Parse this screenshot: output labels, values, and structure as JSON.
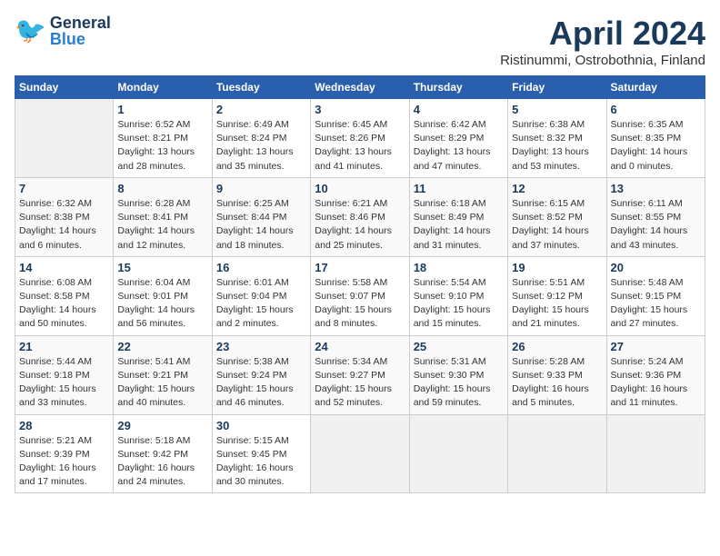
{
  "header": {
    "logo_general": "General",
    "logo_blue": "Blue",
    "month": "April 2024",
    "location": "Ristinummi, Ostrobothnia, Finland"
  },
  "weekdays": [
    "Sunday",
    "Monday",
    "Tuesday",
    "Wednesday",
    "Thursday",
    "Friday",
    "Saturday"
  ],
  "weeks": [
    [
      {
        "day": "",
        "detail": ""
      },
      {
        "day": "1",
        "detail": "Sunrise: 6:52 AM\nSunset: 8:21 PM\nDaylight: 13 hours\nand 28 minutes."
      },
      {
        "day": "2",
        "detail": "Sunrise: 6:49 AM\nSunset: 8:24 PM\nDaylight: 13 hours\nand 35 minutes."
      },
      {
        "day": "3",
        "detail": "Sunrise: 6:45 AM\nSunset: 8:26 PM\nDaylight: 13 hours\nand 41 minutes."
      },
      {
        "day": "4",
        "detail": "Sunrise: 6:42 AM\nSunset: 8:29 PM\nDaylight: 13 hours\nand 47 minutes."
      },
      {
        "day": "5",
        "detail": "Sunrise: 6:38 AM\nSunset: 8:32 PM\nDaylight: 13 hours\nand 53 minutes."
      },
      {
        "day": "6",
        "detail": "Sunrise: 6:35 AM\nSunset: 8:35 PM\nDaylight: 14 hours\nand 0 minutes."
      }
    ],
    [
      {
        "day": "7",
        "detail": "Sunrise: 6:32 AM\nSunset: 8:38 PM\nDaylight: 14 hours\nand 6 minutes."
      },
      {
        "day": "8",
        "detail": "Sunrise: 6:28 AM\nSunset: 8:41 PM\nDaylight: 14 hours\nand 12 minutes."
      },
      {
        "day": "9",
        "detail": "Sunrise: 6:25 AM\nSunset: 8:44 PM\nDaylight: 14 hours\nand 18 minutes."
      },
      {
        "day": "10",
        "detail": "Sunrise: 6:21 AM\nSunset: 8:46 PM\nDaylight: 14 hours\nand 25 minutes."
      },
      {
        "day": "11",
        "detail": "Sunrise: 6:18 AM\nSunset: 8:49 PM\nDaylight: 14 hours\nand 31 minutes."
      },
      {
        "day": "12",
        "detail": "Sunrise: 6:15 AM\nSunset: 8:52 PM\nDaylight: 14 hours\nand 37 minutes."
      },
      {
        "day": "13",
        "detail": "Sunrise: 6:11 AM\nSunset: 8:55 PM\nDaylight: 14 hours\nand 43 minutes."
      }
    ],
    [
      {
        "day": "14",
        "detail": "Sunrise: 6:08 AM\nSunset: 8:58 PM\nDaylight: 14 hours\nand 50 minutes."
      },
      {
        "day": "15",
        "detail": "Sunrise: 6:04 AM\nSunset: 9:01 PM\nDaylight: 14 hours\nand 56 minutes."
      },
      {
        "day": "16",
        "detail": "Sunrise: 6:01 AM\nSunset: 9:04 PM\nDaylight: 15 hours\nand 2 minutes."
      },
      {
        "day": "17",
        "detail": "Sunrise: 5:58 AM\nSunset: 9:07 PM\nDaylight: 15 hours\nand 8 minutes."
      },
      {
        "day": "18",
        "detail": "Sunrise: 5:54 AM\nSunset: 9:10 PM\nDaylight: 15 hours\nand 15 minutes."
      },
      {
        "day": "19",
        "detail": "Sunrise: 5:51 AM\nSunset: 9:12 PM\nDaylight: 15 hours\nand 21 minutes."
      },
      {
        "day": "20",
        "detail": "Sunrise: 5:48 AM\nSunset: 9:15 PM\nDaylight: 15 hours\nand 27 minutes."
      }
    ],
    [
      {
        "day": "21",
        "detail": "Sunrise: 5:44 AM\nSunset: 9:18 PM\nDaylight: 15 hours\nand 33 minutes."
      },
      {
        "day": "22",
        "detail": "Sunrise: 5:41 AM\nSunset: 9:21 PM\nDaylight: 15 hours\nand 40 minutes."
      },
      {
        "day": "23",
        "detail": "Sunrise: 5:38 AM\nSunset: 9:24 PM\nDaylight: 15 hours\nand 46 minutes."
      },
      {
        "day": "24",
        "detail": "Sunrise: 5:34 AM\nSunset: 9:27 PM\nDaylight: 15 hours\nand 52 minutes."
      },
      {
        "day": "25",
        "detail": "Sunrise: 5:31 AM\nSunset: 9:30 PM\nDaylight: 15 hours\nand 59 minutes."
      },
      {
        "day": "26",
        "detail": "Sunrise: 5:28 AM\nSunset: 9:33 PM\nDaylight: 16 hours\nand 5 minutes."
      },
      {
        "day": "27",
        "detail": "Sunrise: 5:24 AM\nSunset: 9:36 PM\nDaylight: 16 hours\nand 11 minutes."
      }
    ],
    [
      {
        "day": "28",
        "detail": "Sunrise: 5:21 AM\nSunset: 9:39 PM\nDaylight: 16 hours\nand 17 minutes."
      },
      {
        "day": "29",
        "detail": "Sunrise: 5:18 AM\nSunset: 9:42 PM\nDaylight: 16 hours\nand 24 minutes."
      },
      {
        "day": "30",
        "detail": "Sunrise: 5:15 AM\nSunset: 9:45 PM\nDaylight: 16 hours\nand 30 minutes."
      },
      {
        "day": "",
        "detail": ""
      },
      {
        "day": "",
        "detail": ""
      },
      {
        "day": "",
        "detail": ""
      },
      {
        "day": "",
        "detail": ""
      }
    ]
  ]
}
